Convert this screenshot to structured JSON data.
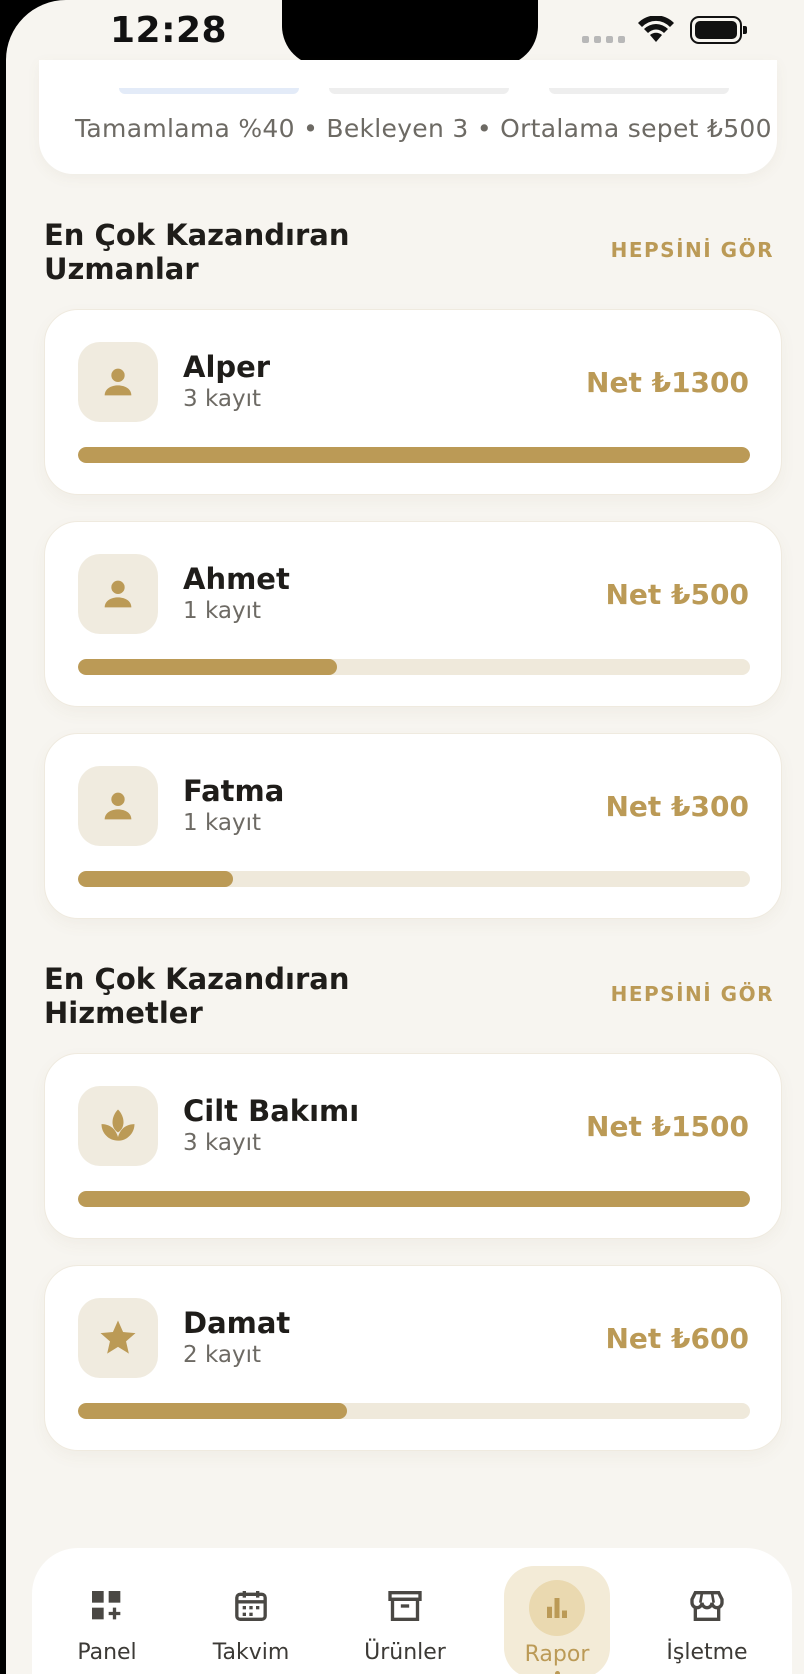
{
  "status_bar": {
    "time": "12:28"
  },
  "stats": {
    "summary": "Tamamlama %40 • Bekleyen 3 • Ortalama sepet ₺500"
  },
  "experts": {
    "title": "En Çok Kazandıran Uzmanlar",
    "see_all": "HEPSİNİ GÖR",
    "items": [
      {
        "name": "Alper",
        "sub": "3 kayıt",
        "net": "Net ₺1300",
        "progress": 1.0,
        "icon": "person-icon"
      },
      {
        "name": "Ahmet",
        "sub": "1 kayıt",
        "net": "Net ₺500",
        "progress": 0.385,
        "icon": "person-icon"
      },
      {
        "name": "Fatma",
        "sub": "1 kayıt",
        "net": "Net ₺300",
        "progress": 0.23,
        "icon": "person-icon"
      }
    ]
  },
  "services": {
    "title": "En Çok Kazandıran Hizmetler",
    "see_all": "HEPSİNİ GÖR",
    "items": [
      {
        "name": "Cilt Bakımı",
        "sub": "3 kayıt",
        "net": "Net ₺1500",
        "progress": 1.0,
        "icon": "spa-icon"
      },
      {
        "name": "Damat",
        "sub": "2 kayıt",
        "net": "Net ₺600",
        "progress": 0.4,
        "icon": "star-icon"
      }
    ]
  },
  "nav": {
    "items": [
      {
        "label": "Panel",
        "icon": "dashboard-icon",
        "active": false
      },
      {
        "label": "Takvim",
        "icon": "calendar-icon",
        "active": false
      },
      {
        "label": "Ürünler",
        "icon": "archive-icon",
        "active": false
      },
      {
        "label": "Rapor",
        "icon": "bar-chart-icon",
        "active": true
      },
      {
        "label": "İşletme",
        "icon": "store-icon",
        "active": false
      }
    ]
  },
  "colors": {
    "accent": "#bb9a56",
    "track": "#efe9db",
    "background": "#f7f5f0"
  }
}
